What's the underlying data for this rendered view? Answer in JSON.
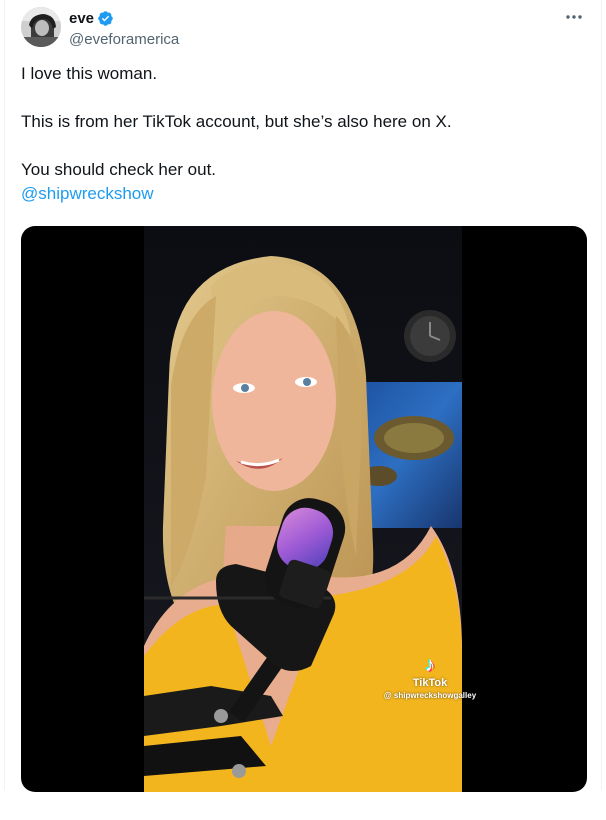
{
  "tweet": {
    "author": {
      "display_name": "eve",
      "handle": "@eveforamerica",
      "verified": true
    },
    "more_label": "···",
    "text": {
      "line1": "I love this woman.",
      "line2": "This is from her TikTok account, but she’s also here on X.",
      "line3": "You should check her out.",
      "mention": "@shipwreckshow"
    },
    "media": {
      "type": "video",
      "description_icon": "video-thumbnail",
      "watermark": {
        "logo_glyph": "♪",
        "brand": "TikTok",
        "user": "@ shipwreckshowgalley"
      }
    }
  },
  "colors": {
    "link": "#1d9bf0",
    "verified": "#1d9bf0",
    "text": "#0f1419",
    "secondary": "#536471",
    "media_bg": "#000000",
    "shirt": "#f2b51e"
  }
}
